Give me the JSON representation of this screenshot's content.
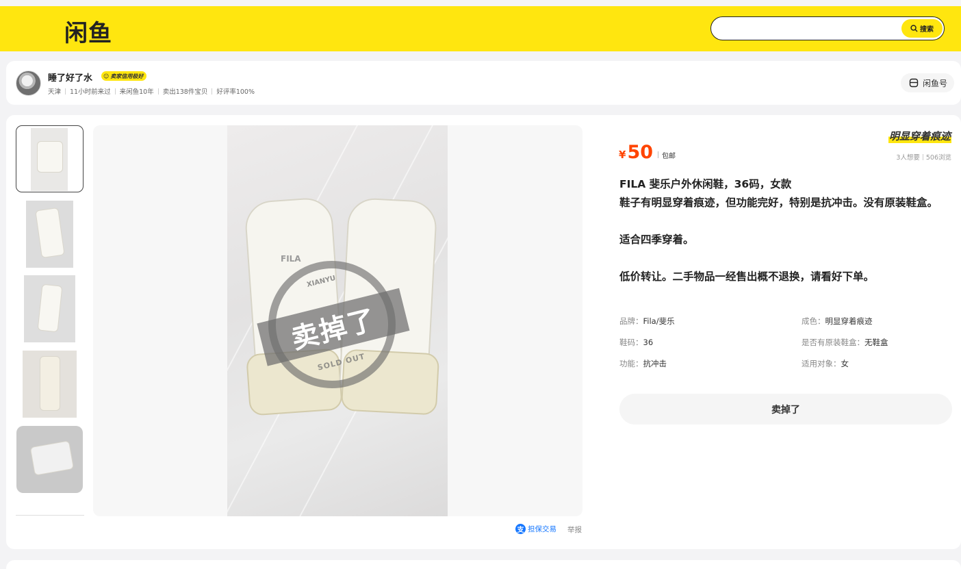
{
  "header": {
    "logo": "闲鱼",
    "search_placeholder": "",
    "search_button": "搜索"
  },
  "seller": {
    "name": "睡了好了水",
    "credit_badge": "卖家信用极好",
    "meta": [
      "天津",
      "11小时前来过",
      "来闲鱼10年",
      "卖出138件宝贝",
      "好评率100%"
    ],
    "xianyu_id": "闲鱼号"
  },
  "product": {
    "tag_title": "明显穿着痕迹",
    "price_symbol": "¥",
    "price": "50",
    "shipping": "包邮",
    "wants": "3人想要",
    "views": "506浏览",
    "description": [
      "FILA 斐乐户外休闲鞋，36码，女款",
      "鞋子有明显穿着痕迹，但功能完好，特别是抗冲击。没有原装鞋盒。",
      "",
      "适合四季穿着。",
      "",
      "低价转让。二手物品一经售出概不退换，请看好下单。"
    ],
    "properties": [
      {
        "key": "品牌：",
        "value": "Fila/斐乐"
      },
      {
        "key": "成色：",
        "value": "明显穿着痕迹"
      },
      {
        "key": "鞋码：",
        "value": "36"
      },
      {
        "key": "是否有原装鞋盒：",
        "value": "无鞋盒"
      },
      {
        "key": "功能：",
        "value": "抗冲击"
      },
      {
        "key": "适用对象：",
        "value": "女"
      }
    ],
    "status_button": "卖掉了",
    "stamp": {
      "text": "卖掉了",
      "top_text": "XIANYU",
      "bottom_text": "SOLD OUT"
    },
    "photo_logo": "FILA"
  },
  "footer_links": {
    "guarantee_icon": "支",
    "guarantee": "担保交易",
    "report": "举报"
  },
  "colors": {
    "brand_yellow": "#ffe60f",
    "price_orange": "#ff4400",
    "link_blue": "#1677ff"
  }
}
